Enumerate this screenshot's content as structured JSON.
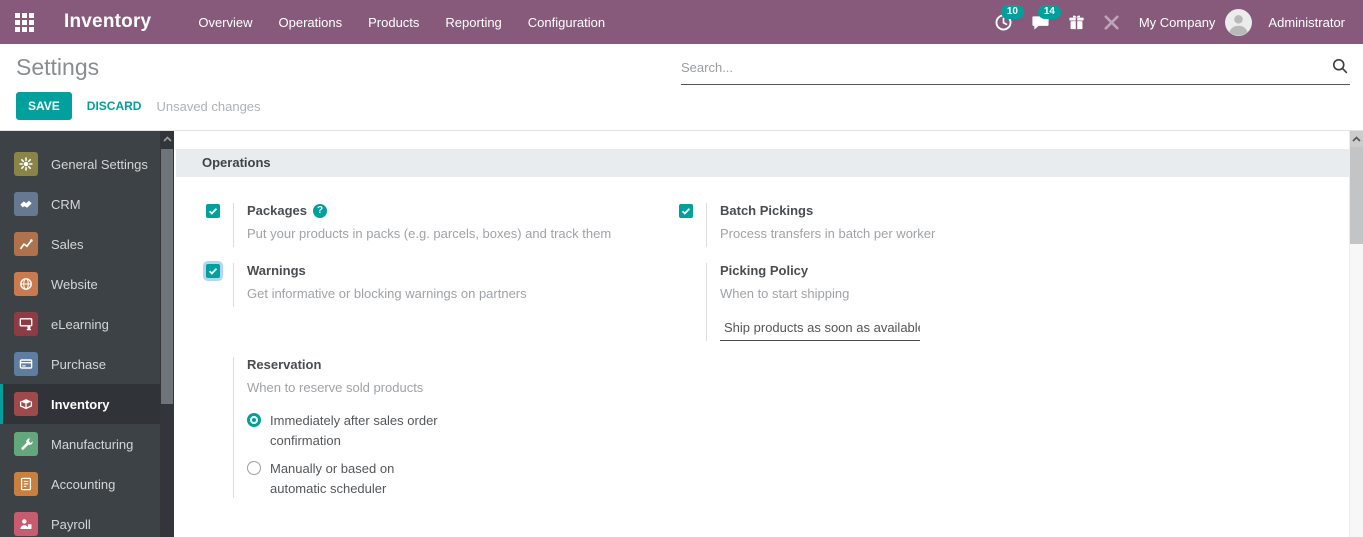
{
  "navbar": {
    "brand": "Inventory",
    "menu_items": [
      "Overview",
      "Operations",
      "Products",
      "Reporting",
      "Configuration"
    ],
    "activities_count": "10",
    "messages_count": "14",
    "company": "My Company",
    "user": "Administrator",
    "bg_color": "#875A7B",
    "badge_color": "#00A09D"
  },
  "control_panel": {
    "title": "Settings",
    "save_label": "SAVE",
    "discard_label": "DISCARD",
    "status_text": "Unsaved changes",
    "search_placeholder": "Search..."
  },
  "sidebar": {
    "items": [
      {
        "label": "General Settings",
        "icon": "gear-icon",
        "color": "#8a8448",
        "selected": false
      },
      {
        "label": "CRM",
        "icon": "handshake-icon",
        "color": "#667991",
        "selected": false
      },
      {
        "label": "Sales",
        "icon": "chart-icon",
        "color": "#b0714d",
        "selected": false
      },
      {
        "label": "Website",
        "icon": "globe-icon",
        "color": "#c97b4e",
        "selected": false
      },
      {
        "label": "eLearning",
        "icon": "presentation-icon",
        "color": "#8d3b45",
        "selected": false
      },
      {
        "label": "Purchase",
        "icon": "card-icon",
        "color": "#5e7da0",
        "selected": false
      },
      {
        "label": "Inventory",
        "icon": "box-icon",
        "color": "#9e4a4a",
        "selected": true
      },
      {
        "label": "Manufacturing",
        "icon": "wrench-icon",
        "color": "#64a77c",
        "selected": false
      },
      {
        "label": "Accounting",
        "icon": "invoice-icon",
        "color": "#c9803f",
        "selected": false
      },
      {
        "label": "Payroll",
        "icon": "employee-icon",
        "color": "#c75c71",
        "selected": false
      }
    ]
  },
  "main": {
    "section_title": "Operations",
    "packages": {
      "label": "Packages",
      "description": "Put your products in packs (e.g. parcels, boxes) and track them",
      "checked": true
    },
    "batch_pickings": {
      "label": "Batch Pickings",
      "description": "Process transfers in batch per worker",
      "checked": true
    },
    "warnings": {
      "label": "Warnings",
      "description": "Get informative or blocking warnings on partners",
      "checked": true
    },
    "picking_policy": {
      "label": "Picking Policy",
      "description": "When to start shipping",
      "selected_value": "Ship products as soon as available"
    },
    "reservation": {
      "label": "Reservation",
      "description": "When to reserve sold products",
      "options": [
        {
          "label": "Immediately after sales order confirmation",
          "selected": true
        },
        {
          "label": "Manually or based on automatic scheduler",
          "selected": false
        }
      ]
    }
  },
  "accent_color": "#00A09D"
}
